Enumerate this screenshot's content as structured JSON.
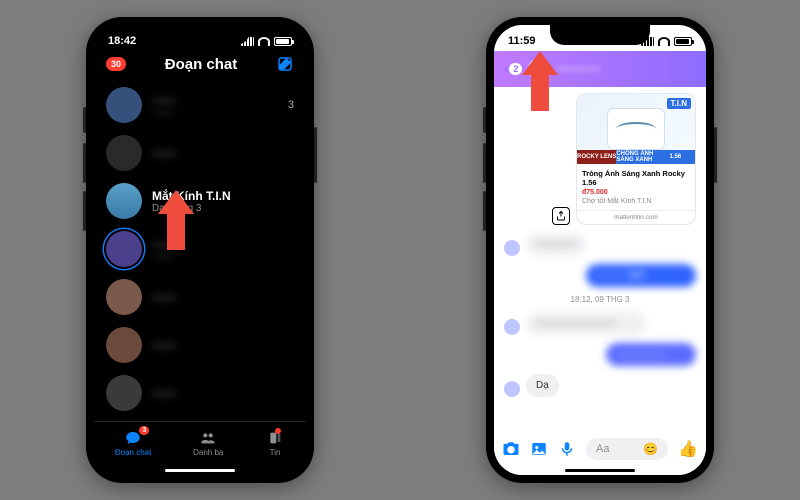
{
  "left": {
    "status": {
      "time": "18:42"
    },
    "header": {
      "badge": "30",
      "title": "Đoạn chat"
    },
    "chats": [
      {
        "name": "——",
        "sub": "——",
        "blurred": true,
        "unread": "3"
      },
      {
        "name": "——",
        "sub": "",
        "blurred": true
      },
      {
        "name": "Mắt Kính T.I.N",
        "sub": "Dạ· 9 thg 3",
        "blurred": false
      },
      {
        "name": "——",
        "sub": "——",
        "blurred": true,
        "story": true
      },
      {
        "name": "——",
        "sub": "",
        "blurred": true
      },
      {
        "name": "——",
        "sub": "",
        "blurred": true
      },
      {
        "name": "——",
        "sub": "",
        "blurred": true
      },
      {
        "name": "——",
        "sub": "",
        "blurred": true
      }
    ],
    "tabs": [
      {
        "label": "Đoạn chat",
        "badge": "3",
        "active": true
      },
      {
        "label": "Danh bạ"
      },
      {
        "label": "Tin",
        "dot": true
      }
    ]
  },
  "right": {
    "status": {
      "time": "11:59"
    },
    "header": {
      "back_count": "2",
      "title": "————"
    },
    "product": {
      "brand": "T.I.N",
      "band_a": "ROCKY LENS",
      "band_b": "CHỐNG ÁNH SÁNG XANH",
      "band_c": "1.56",
      "title": "Tròng Ánh Sáng Xanh Rocky 1.56",
      "price": "đ75.000",
      "shop": "Chợ tốt Mắt Kính T.I.N",
      "url": "matkinhtin.com"
    },
    "timestamp": "18:12, 09 THG 3",
    "last_msg": "Dạ",
    "composer": {
      "placeholder": "Aa"
    }
  },
  "avatar_colors": [
    "#35507a",
    "#2a2a2a",
    "#6aa7c8",
    "#4a3f8a",
    "#7a5a4a",
    "#6a4a3a",
    "#3a3a3a",
    "#8a5a6a"
  ],
  "brand_blue": "#0a84ff"
}
